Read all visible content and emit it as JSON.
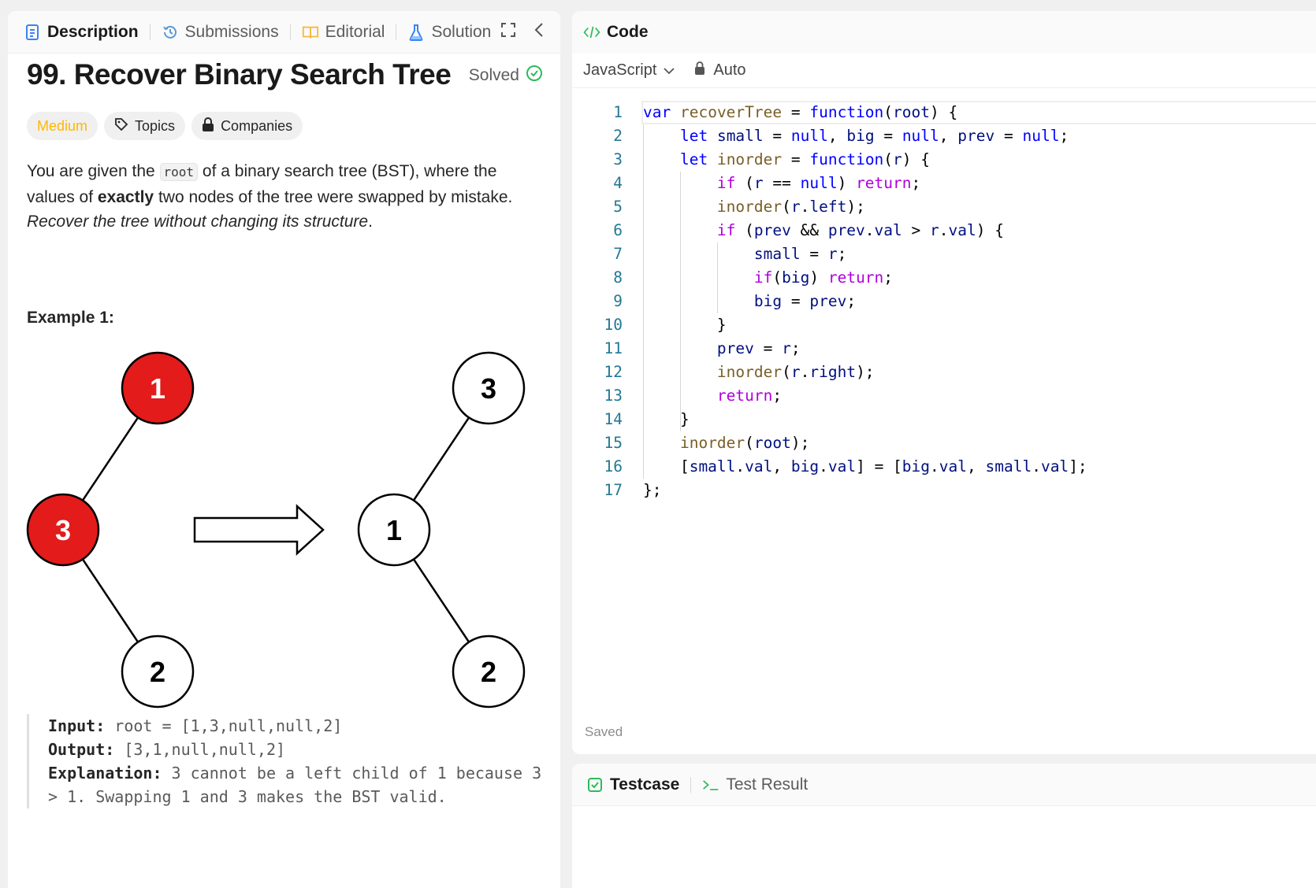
{
  "left_tabs": [
    {
      "label": "Description",
      "icon": "description-icon",
      "active": true
    },
    {
      "label": "Submissions",
      "icon": "history-icon",
      "active": false
    },
    {
      "label": "Editorial",
      "icon": "book-icon",
      "active": false
    },
    {
      "label": "Solution",
      "icon": "flask-icon",
      "active": false
    }
  ],
  "problem": {
    "title": "99. Recover Binary Search Tree",
    "status": "Solved",
    "tags": {
      "difficulty": "Medium",
      "topics": "Topics",
      "companies": "Companies"
    },
    "desc": {
      "p1": "You are given the ",
      "root_code": "root",
      "p2": " of a binary search tree (BST), where the values of ",
      "exactly": "exactly",
      "p3": " two nodes of the tree were swapped by mistake.",
      "italic": "Recover the tree without changing its structure",
      "period": "."
    },
    "example_title": "Example 1:",
    "figure": {
      "left_tree": {
        "root": "1",
        "left": "3",
        "left_right": "2"
      },
      "right_tree": {
        "root": "3",
        "left": "1",
        "left_right": "2"
      },
      "swapped_color": "#e31b1b"
    },
    "example": {
      "input_label": "Input:",
      "input_value": " root = [1,3,null,null,2]",
      "output_label": "Output:",
      "output_value": " [3,1,null,null,2]",
      "explanation_label": "Explanation:",
      "explanation_value": " 3 cannot be a left child of 1 because 3 > 1. Swapping 1 and 3 makes the BST valid."
    }
  },
  "code_panel": {
    "title": "Code",
    "icon": "code-icon",
    "language": "JavaScript",
    "mode": "Auto",
    "saved": "Saved",
    "line_numbers": [
      "1",
      "2",
      "3",
      "4",
      "5",
      "6",
      "7",
      "8",
      "9",
      "10",
      "11",
      "12",
      "13",
      "14",
      "15",
      "16",
      "17"
    ],
    "lines": [
      [
        [
          "kw",
          "var"
        ],
        [
          "pn",
          " "
        ],
        [
          "fn",
          "recoverTree"
        ],
        [
          "pn",
          " = "
        ],
        [
          "kw",
          "function"
        ],
        [
          "pn",
          "("
        ],
        [
          "id",
          "root"
        ],
        [
          "pn",
          ") {"
        ]
      ],
      [
        [
          "pn",
          "    "
        ],
        [
          "kw",
          "let"
        ],
        [
          "pn",
          " "
        ],
        [
          "id",
          "small"
        ],
        [
          "pn",
          " = "
        ],
        [
          "kw",
          "null"
        ],
        [
          "pn",
          ", "
        ],
        [
          "id",
          "big"
        ],
        [
          "pn",
          " = "
        ],
        [
          "kw",
          "null"
        ],
        [
          "pn",
          ", "
        ],
        [
          "id",
          "prev"
        ],
        [
          "pn",
          " = "
        ],
        [
          "kw",
          "null"
        ],
        [
          "pn",
          ";"
        ]
      ],
      [
        [
          "pn",
          "    "
        ],
        [
          "kw",
          "let"
        ],
        [
          "pn",
          " "
        ],
        [
          "fn",
          "inorder"
        ],
        [
          "pn",
          " = "
        ],
        [
          "kw",
          "function"
        ],
        [
          "pn",
          "("
        ],
        [
          "id",
          "r"
        ],
        [
          "pn",
          ") {"
        ]
      ],
      [
        [
          "pn",
          "        "
        ],
        [
          "ctl",
          "if"
        ],
        [
          "pn",
          " ("
        ],
        [
          "id",
          "r"
        ],
        [
          "pn",
          " == "
        ],
        [
          "kw",
          "null"
        ],
        [
          "pn",
          ") "
        ],
        [
          "ctl",
          "return"
        ],
        [
          "pn",
          ";"
        ]
      ],
      [
        [
          "pn",
          "        "
        ],
        [
          "fn",
          "inorder"
        ],
        [
          "pn",
          "("
        ],
        [
          "id",
          "r"
        ],
        [
          "pn",
          "."
        ],
        [
          "id",
          "left"
        ],
        [
          "pn",
          ");"
        ]
      ],
      [
        [
          "pn",
          "        "
        ],
        [
          "ctl",
          "if"
        ],
        [
          "pn",
          " ("
        ],
        [
          "id",
          "prev"
        ],
        [
          "pn",
          " && "
        ],
        [
          "id",
          "prev"
        ],
        [
          "pn",
          "."
        ],
        [
          "id",
          "val"
        ],
        [
          "pn",
          " > "
        ],
        [
          "id",
          "r"
        ],
        [
          "pn",
          "."
        ],
        [
          "id",
          "val"
        ],
        [
          "pn",
          ") {"
        ]
      ],
      [
        [
          "pn",
          "            "
        ],
        [
          "id",
          "small"
        ],
        [
          "pn",
          " = "
        ],
        [
          "id",
          "r"
        ],
        [
          "pn",
          ";"
        ]
      ],
      [
        [
          "pn",
          "            "
        ],
        [
          "ctl",
          "if"
        ],
        [
          "pn",
          "("
        ],
        [
          "id",
          "big"
        ],
        [
          "pn",
          ") "
        ],
        [
          "ctl",
          "return"
        ],
        [
          "pn",
          ";"
        ]
      ],
      [
        [
          "pn",
          "            "
        ],
        [
          "id",
          "big"
        ],
        [
          "pn",
          " = "
        ],
        [
          "id",
          "prev"
        ],
        [
          "pn",
          ";"
        ]
      ],
      [
        [
          "pn",
          "        }"
        ]
      ],
      [
        [
          "pn",
          "        "
        ],
        [
          "id",
          "prev"
        ],
        [
          "pn",
          " = "
        ],
        [
          "id",
          "r"
        ],
        [
          "pn",
          ";"
        ]
      ],
      [
        [
          "pn",
          "        "
        ],
        [
          "fn",
          "inorder"
        ],
        [
          "pn",
          "("
        ],
        [
          "id",
          "r"
        ],
        [
          "pn",
          "."
        ],
        [
          "id",
          "right"
        ],
        [
          "pn",
          ");"
        ]
      ],
      [
        [
          "pn",
          "        "
        ],
        [
          "ctl",
          "return"
        ],
        [
          "pn",
          ";"
        ]
      ],
      [
        [
          "pn",
          "    }"
        ]
      ],
      [
        [
          "pn",
          "    "
        ],
        [
          "fn",
          "inorder"
        ],
        [
          "pn",
          "("
        ],
        [
          "id",
          "root"
        ],
        [
          "pn",
          ");"
        ]
      ],
      [
        [
          "pn",
          "    ["
        ],
        [
          "id",
          "small"
        ],
        [
          "pn",
          "."
        ],
        [
          "id",
          "val"
        ],
        [
          "pn",
          ", "
        ],
        [
          "id",
          "big"
        ],
        [
          "pn",
          "."
        ],
        [
          "id",
          "val"
        ],
        [
          "pn",
          "] = ["
        ],
        [
          "id",
          "big"
        ],
        [
          "pn",
          "."
        ],
        [
          "id",
          "val"
        ],
        [
          "pn",
          ", "
        ],
        [
          "id",
          "small"
        ],
        [
          "pn",
          "."
        ],
        [
          "id",
          "val"
        ],
        [
          "pn",
          "];"
        ]
      ],
      [
        [
          "pn",
          "};"
        ]
      ]
    ]
  },
  "bottom_tabs": [
    {
      "label": "Testcase",
      "icon": "checkbox-icon",
      "active": true
    },
    {
      "label": "Test Result",
      "icon": "terminal-icon",
      "active": false
    }
  ],
  "colors": {
    "accent_green": "#2cbb5d",
    "medium": "#ffb700",
    "blue_icon": "#3b82f6"
  }
}
